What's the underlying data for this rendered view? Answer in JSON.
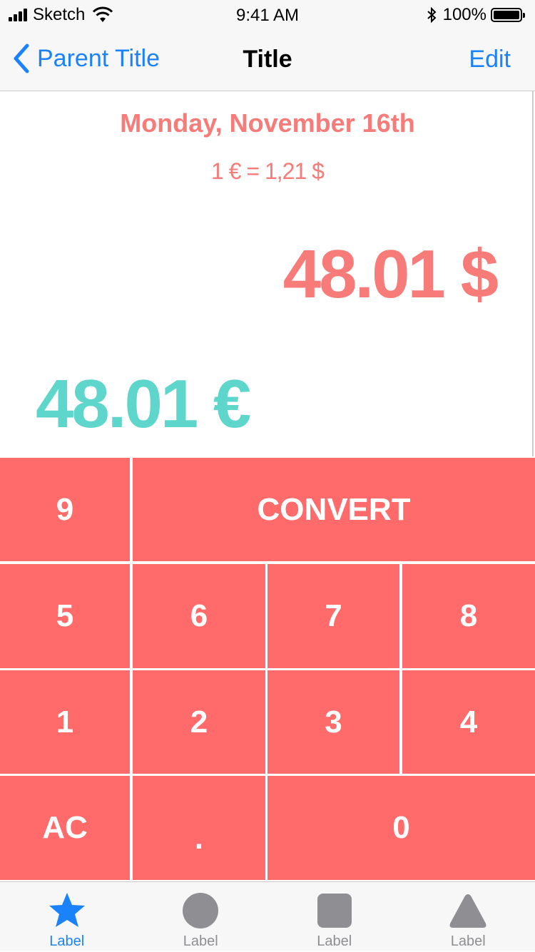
{
  "status_bar": {
    "carrier": "Sketch",
    "time": "9:41 AM",
    "battery": "100%"
  },
  "nav": {
    "back_label": "Parent Title",
    "title": "Title",
    "edit_label": "Edit"
  },
  "content": {
    "date": "Monday, November 16th",
    "rate": "1 € = 1,21 $",
    "amount_dollar": "48.01 $",
    "amount_euro": "48.01 €"
  },
  "keypad": {
    "k9": "9",
    "convert": "CONVERT",
    "k5": "5",
    "k6": "6",
    "k7": "7",
    "k8": "8",
    "k1": "1",
    "k2": "2",
    "k3": "3",
    "k4": "4",
    "clear": "AC",
    "decimal": ".",
    "k0": "0"
  },
  "tab_bar": {
    "items": [
      {
        "label": "Label",
        "icon": "star-icon",
        "active": true
      },
      {
        "label": "Label",
        "icon": "circle-icon",
        "active": false
      },
      {
        "label": "Label",
        "icon": "square-icon",
        "active": false
      },
      {
        "label": "Label",
        "icon": "triangle-icon",
        "active": false
      }
    ]
  },
  "colors": {
    "accent_red": "#ff6b6b",
    "text_red": "#f77b78",
    "teal": "#5fd6cc",
    "ios_blue": "#1a82fb",
    "tab_gray": "#8e8e93"
  }
}
